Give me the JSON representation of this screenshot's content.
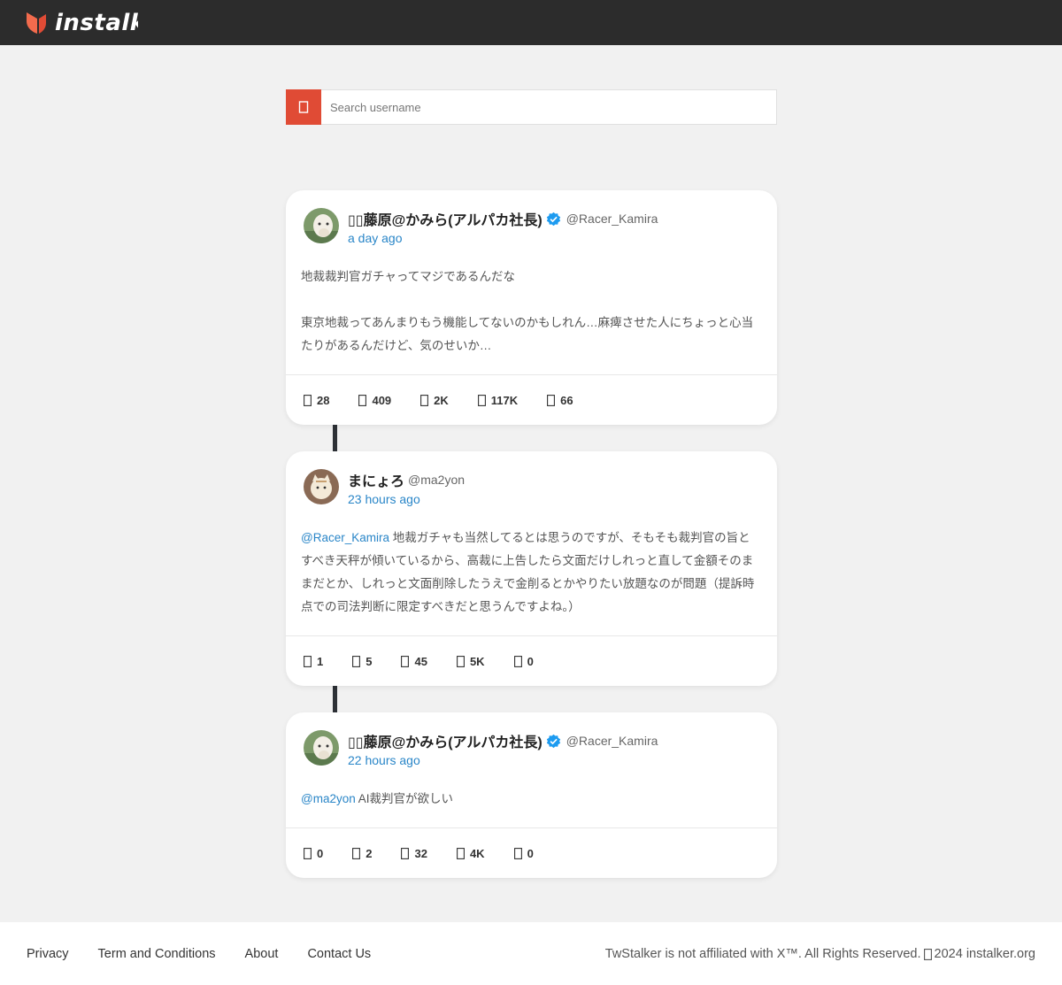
{
  "header": {
    "brand": "instalk"
  },
  "search": {
    "placeholder": "Search username"
  },
  "tweets": [
    {
      "display_name": "藤原@かみら(アルパカ社長)",
      "prefix_glyphs": "▯▯",
      "suffix_glyph": "▯",
      "verified": true,
      "handle": "@Racer_Kamira",
      "time": "a day ago",
      "paragraphs": [
        "地裁裁判官ガチャってマジであるんだな",
        "東京地裁ってあんまりもう機能してないのかもしれん…麻痺させた人にちょっと心当たりがあるんだけど、気のせいか…"
      ],
      "stats": [
        "28",
        "409",
        "2K",
        "117K",
        "66"
      ]
    },
    {
      "display_name": "まにょろ",
      "verified": false,
      "handle": "@ma2yon",
      "time": "23 hours ago",
      "mention": "@Racer_Kamira",
      "text": " 地裁ガチャも当然してるとは思うのですが、そもそも裁判官の旨とすべき天秤が傾いているから、高裁に上告したら文面だけしれっと直して金額そのままだとか、しれっと文面削除したうえで金削るとかやりたい放題なのが問題（提訴時点での司法判断に限定すべきだと思うんですよね。）",
      "stats": [
        "1",
        "5",
        "45",
        "5K",
        "0"
      ]
    },
    {
      "display_name": "藤原@かみら(アルパカ社長)",
      "prefix_glyphs": "▯▯",
      "suffix_glyph": "▯",
      "verified": true,
      "handle": "@Racer_Kamira",
      "time": "22 hours ago",
      "mention": "@ma2yon",
      "text": " AI裁判官が欲しい",
      "stats": [
        "0",
        "2",
        "32",
        "4K",
        "0"
      ]
    }
  ],
  "footer": {
    "links": [
      "Privacy",
      "Term and Conditions",
      "About",
      "Contact Us"
    ],
    "disclaimer": "TwStalker is not affiliated with X™. All Rights Reserved.",
    "copyright": "2024 instalker.org"
  },
  "colors": {
    "accent": "#e04b35",
    "link": "#2a86c8",
    "header_bg": "#2c2c2c",
    "verified": "#1d9bf0"
  },
  "icons": {
    "stat": "placeholder-box-icon",
    "search": "search-icon",
    "verified": "verified-badge-icon"
  }
}
